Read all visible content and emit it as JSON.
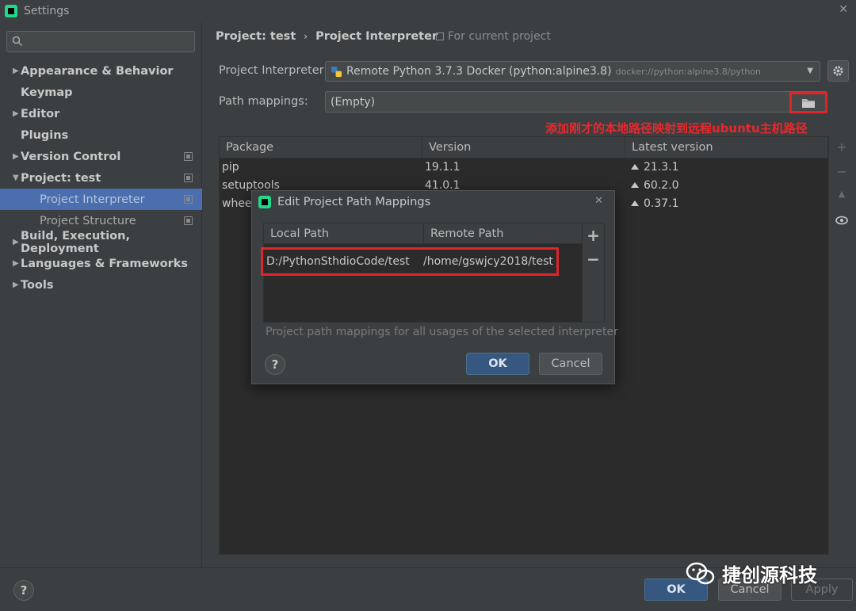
{
  "window": {
    "title": "Settings"
  },
  "sidebar": {
    "search_placeholder": "",
    "items": [
      {
        "label": "Appearance & Behavior",
        "arrow": "▶",
        "copy": false
      },
      {
        "label": "Keymap",
        "arrow": "",
        "copy": false
      },
      {
        "label": "Editor",
        "arrow": "▶",
        "copy": false
      },
      {
        "label": "Plugins",
        "arrow": "",
        "copy": false
      },
      {
        "label": "Version Control",
        "arrow": "▶",
        "copy": true
      },
      {
        "label": "Project: test",
        "arrow": "▼",
        "copy": true
      },
      {
        "label": "Project Interpreter",
        "arrow": "",
        "copy": true
      },
      {
        "label": "Project Structure",
        "arrow": "",
        "copy": true
      },
      {
        "label": "Build, Execution, Deployment",
        "arrow": "▶",
        "copy": false
      },
      {
        "label": "Languages & Frameworks",
        "arrow": "▶",
        "copy": false
      },
      {
        "label": "Tools",
        "arrow": "▶",
        "copy": false
      }
    ]
  },
  "breadcrumb": {
    "root": "Project: test",
    "sep": "›",
    "current": "Project Interpreter"
  },
  "scope_label": "For current project",
  "interpreter": {
    "label": "Project Interpreter:",
    "value": "Remote Python 3.7.3 Docker (python:alpine3.8)",
    "path": "docker://python:alpine3.8/python"
  },
  "path_mappings": {
    "label": "Path mappings:",
    "value": "(Empty)"
  },
  "annotation": "添加刚才的本地路径映射到远程ubuntu主机路径",
  "packages": {
    "headers": [
      "Package",
      "Version",
      "Latest version"
    ],
    "rows": [
      [
        "pip",
        "19.1.1",
        "21.3.1"
      ],
      [
        "setuptools",
        "41.0.1",
        "60.2.0"
      ],
      [
        "wheel",
        "",
        "0.37.1"
      ]
    ]
  },
  "side_tools": [
    "+",
    "−",
    "▲",
    "👁"
  ],
  "dialog": {
    "title": "Edit Project Path Mappings",
    "headers": [
      "Local Path",
      "Remote Path"
    ],
    "row": {
      "local": "D:/PythonSthdioCode/test",
      "remote": "/home/gswjcy2018/test"
    },
    "add": "+",
    "remove": "−",
    "hint": "Project path mappings for all usages of the selected interpreter",
    "help": "?",
    "ok": "OK",
    "cancel": "Cancel"
  },
  "footer": {
    "help": "?",
    "ok": "OK",
    "cancel": "Cancel",
    "apply": "Apply"
  },
  "watermark": "捷创源科技",
  "colors": {
    "accent": "#4b6eaf",
    "annotation": "#e8282c",
    "ok_button": "#365880"
  }
}
